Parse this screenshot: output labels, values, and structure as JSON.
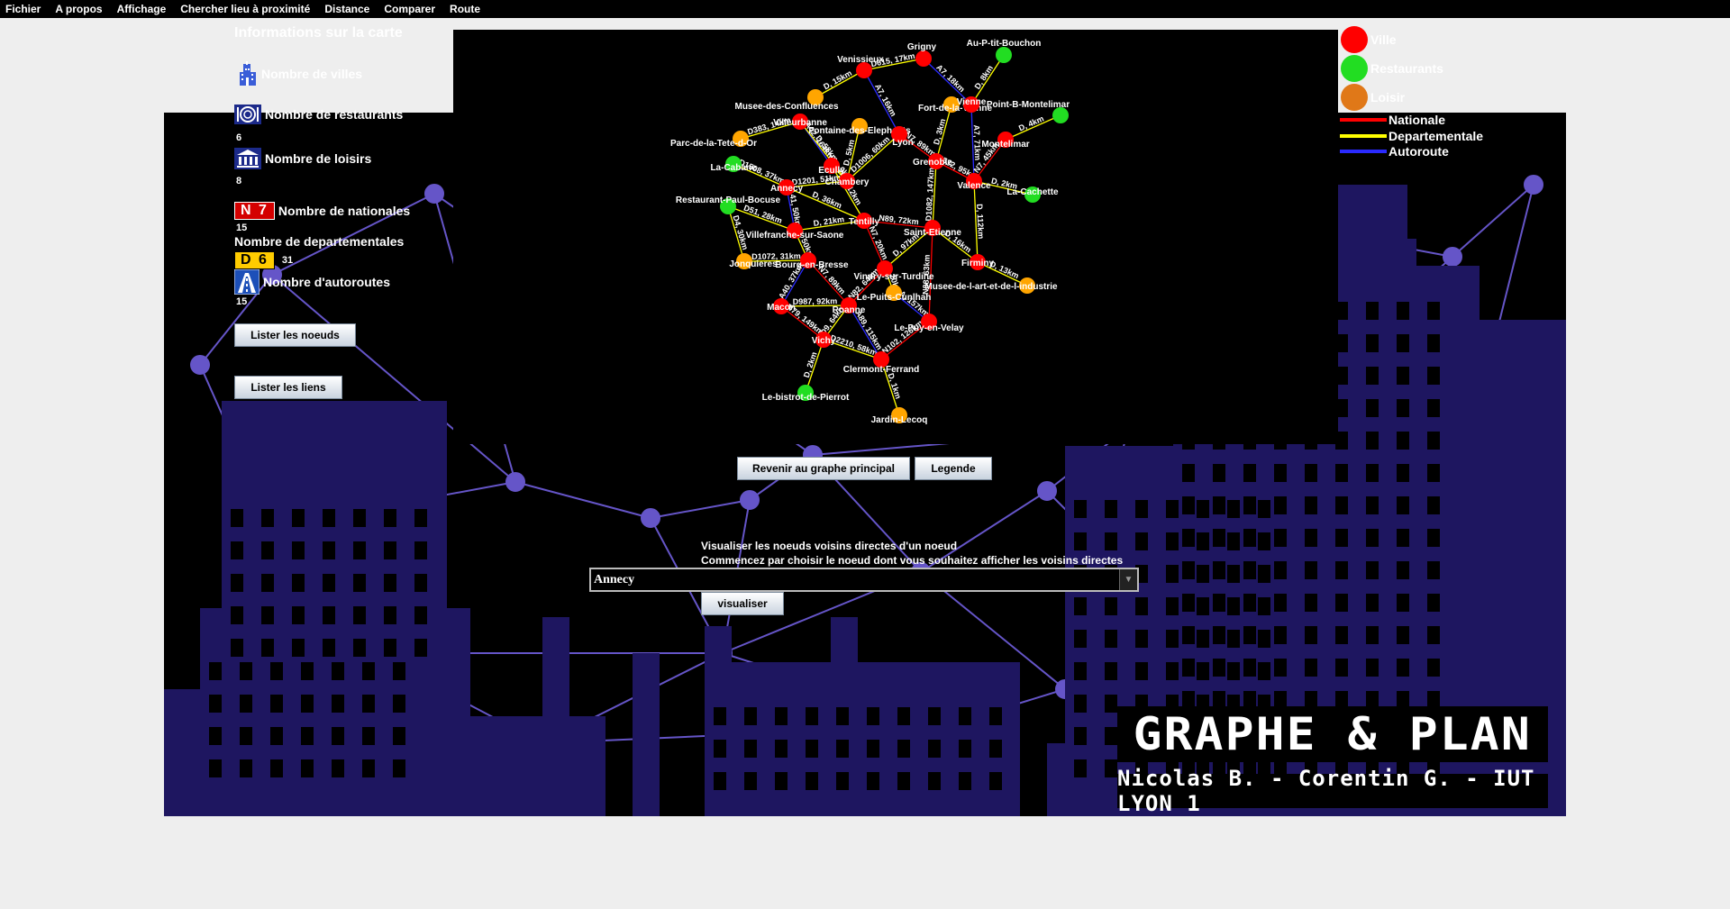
{
  "menu": [
    "Fichier",
    "A propos",
    "Affichage",
    "Chercher lieu à proximité",
    "Distance",
    "Comparer",
    "Route"
  ],
  "info": {
    "title": "Informations sur la carte",
    "villes_label": "Nombre de villes",
    "villes_count": "",
    "restaurants_label": "Nombre de restaurants",
    "restaurants_count": "6",
    "loisirs_label": "Nombre de loisirs",
    "loisirs_count": "8",
    "nationales_sign": "N 7",
    "nationales_label": "Nombre de nationales",
    "nationales_count": "15",
    "departementales_label": "Nombre de departementales",
    "departementales_sign": "D 6",
    "departementales_count": "31",
    "autoroutes_label": "Nombre d'autoroutes",
    "autoroutes_count": "15",
    "list_nodes_button": "Lister les noeuds",
    "list_links_button": "Lister les liens"
  },
  "legend": {
    "ville": "Ville",
    "restaurants": "Restaurants",
    "loisir": "Loisir",
    "nationale": "Nationale",
    "departementale": "Departementale",
    "autoroute": "Autoroute"
  },
  "colors": {
    "ville": "#ff0000",
    "restaurant": "#22dd22",
    "loisir": "#ffa500",
    "loisir_legend": "#e07818",
    "nationale": "#ff0000",
    "departementale": "#ffff00",
    "autoroute": "#2a2aff",
    "scene_navy": "#1e1660",
    "scene_network": "#6555c8"
  },
  "graph_controls": {
    "back_button": "Revenir au graphe principal",
    "legend_button": "Legende"
  },
  "neighbors": {
    "line1": "Visualiser les noeuds voisins directes d'un noeud",
    "line2": "Commencez par choisir le noeud dont vous souhaitez afficher les voisins directes",
    "selected_node": "Annecy",
    "visualize_button": "visualiser"
  },
  "branding": {
    "title": "GRAPHE & PLAN",
    "authors": "Nicolas B. - Corentin G. - IUT LYON 1"
  },
  "graph": {
    "nodes": [
      {
        "id": "grigny",
        "name": "Grigny",
        "type": "ville"
      },
      {
        "id": "au-p-tit-bouchon",
        "name": "Au-P-tit-Bouchon",
        "type": "restaurant"
      },
      {
        "id": "venissieux",
        "name": "Venissieux",
        "type": "ville"
      },
      {
        "id": "musee-confluences",
        "name": "Musee-des-Confluences",
        "type": "loisir"
      },
      {
        "id": "fort-de-la-vienne",
        "name": "Fort-de-la-Vienne",
        "type": "loisir"
      },
      {
        "id": "vienne",
        "name": "Vienne",
        "type": "ville"
      },
      {
        "id": "point-b-montelimar",
        "name": "Point-B-Montelimar",
        "type": "restaurant"
      },
      {
        "id": "villeurbanne",
        "name": "Villeurbanne",
        "type": "ville"
      },
      {
        "id": "fontaine-elephants",
        "name": "Fontaine-des-Elephants",
        "type": "loisir"
      },
      {
        "id": "lyon",
        "name": "Lyon",
        "type": "ville"
      },
      {
        "id": "parc-tete-d-or",
        "name": "Parc-de-la-Tete-d-Or",
        "type": "loisir"
      },
      {
        "id": "montelimar",
        "name": "Montelimar",
        "type": "ville"
      },
      {
        "id": "la-cabane",
        "name": "La-Cabane",
        "type": "restaurant"
      },
      {
        "id": "ecully",
        "name": "Ecully",
        "type": "ville"
      },
      {
        "id": "grenoble",
        "name": "Grenoble",
        "type": "ville"
      },
      {
        "id": "chambery",
        "name": "Chambery",
        "type": "ville"
      },
      {
        "id": "annecy",
        "name": "Annecy",
        "type": "ville"
      },
      {
        "id": "valence",
        "name": "Valence",
        "type": "ville"
      },
      {
        "id": "la-cachette",
        "name": "La-Cachette",
        "type": "restaurant"
      },
      {
        "id": "restaurant-paul-bocuse",
        "name": "Restaurant-Paul-Bocuse",
        "type": "restaurant"
      },
      {
        "id": "tentilly",
        "name": "Tentilly",
        "type": "ville"
      },
      {
        "id": "villefranche",
        "name": "Villefranche-sur-Saone",
        "type": "ville"
      },
      {
        "id": "saint-etienne",
        "name": "Saint-Etienne",
        "type": "ville"
      },
      {
        "id": "jonquieres",
        "name": "Jonquieres",
        "type": "loisir"
      },
      {
        "id": "bourg-en-bresse",
        "name": "Bourg-en-Bresse",
        "type": "ville"
      },
      {
        "id": "vindry",
        "name": "Vindry-sur-Turdine",
        "type": "ville"
      },
      {
        "id": "firminy",
        "name": "Firminy",
        "type": "ville"
      },
      {
        "id": "musee-art-industrie",
        "name": "Musee-de-l-art-et-de-l-industrie",
        "type": "loisir"
      },
      {
        "id": "puits-cunlhah",
        "name": "Le-Puits-Cunlhah",
        "type": "loisir"
      },
      {
        "id": "roanne",
        "name": "Roanne",
        "type": "ville"
      },
      {
        "id": "macon",
        "name": "Macon",
        "type": "ville"
      },
      {
        "id": "le-puy",
        "name": "Le-Puy-en-Velay",
        "type": "ville"
      },
      {
        "id": "vichy",
        "name": "Vichy",
        "type": "ville"
      },
      {
        "id": "clermont",
        "name": "Clermont-Ferrand",
        "type": "ville"
      },
      {
        "id": "bistrot-pierrot",
        "name": "Le-bistrot-de-Pierrot",
        "type": "restaurant"
      },
      {
        "id": "jardin-lecoq",
        "name": "Jardin-Lecoq",
        "type": "loisir"
      }
    ],
    "edges": [
      {
        "from": "venissieux",
        "to": "grigny",
        "road": "departementale",
        "label": "D615, 17km"
      },
      {
        "from": "grigny",
        "to": "vienne",
        "road": "autoroute",
        "label": "A7, 18km"
      },
      {
        "from": "vienne",
        "to": "au-p-tit-bouchon",
        "road": "departementale",
        "label": "D, 8km"
      },
      {
        "from": "venissieux",
        "to": "lyon",
        "road": "autoroute",
        "label": "A7, 16km"
      },
      {
        "from": "musee-confluences",
        "to": "venissieux",
        "road": "departementale",
        "label": "D, 15km"
      },
      {
        "from": "villeurbanne",
        "to": "ecully",
        "road": "autoroute",
        "label": "A42, 164km"
      },
      {
        "from": "parc-tete-d-or",
        "to": "villeurbanne",
        "road": "departementale",
        "label": "D383, 14km"
      },
      {
        "from": "fontaine-elephants",
        "to": "chambery",
        "road": "departementale",
        "label": "D, 5km"
      },
      {
        "from": "lyon",
        "to": "chambery",
        "road": "departementale",
        "label": "D1006, 60km"
      },
      {
        "from": "lyon",
        "to": "grenoble",
        "road": "nationale",
        "label": "N7, 89km"
      },
      {
        "from": "vienne",
        "to": "valence",
        "road": "autoroute",
        "label": "A7, 71km"
      },
      {
        "from": "point-b-montelimar",
        "to": "montelimar",
        "road": "departementale",
        "label": "D, 4km"
      },
      {
        "from": "montelimar",
        "to": "valence",
        "road": "nationale",
        "label": "N7, 45km"
      },
      {
        "from": "valence",
        "to": "la-cachette",
        "road": "departementale",
        "label": "D, 2km"
      },
      {
        "from": "grenoble",
        "to": "valence",
        "road": "nationale",
        "label": "N532, 95km"
      },
      {
        "from": "fort-de-la-vienne",
        "to": "grenoble",
        "road": "departementale",
        "label": "D, 3km"
      },
      {
        "from": "la-cabane",
        "to": "annecy",
        "road": "departementale",
        "label": "D1508, 37km"
      },
      {
        "from": "annecy",
        "to": "chambery",
        "road": "departementale",
        "label": "D1201, 51km"
      },
      {
        "from": "annecy",
        "to": "villefranche",
        "road": "autoroute",
        "label": "A41, 50km"
      },
      {
        "from": "restaurant-paul-bocuse",
        "to": "villefranche",
        "road": "departementale",
        "label": "D51, 28km"
      },
      {
        "from": "restaurant-paul-bocuse",
        "to": "jonquieres",
        "road": "departementale",
        "label": "D4, 30km"
      },
      {
        "from": "ecully",
        "to": "tentilly",
        "road": "departementale",
        "label": "D, 12km"
      },
      {
        "from": "tentilly",
        "to": "villefranche",
        "road": "departementale",
        "label": "D, 21km"
      },
      {
        "from": "tentilly",
        "to": "vindry",
        "road": "nationale",
        "label": "N7, 20km"
      },
      {
        "from": "tentilly",
        "to": "saint-etienne",
        "road": "nationale",
        "label": "N89, 72km"
      },
      {
        "from": "grenoble",
        "to": "saint-etienne",
        "road": "departementale",
        "label": "D1082, 147km"
      },
      {
        "from": "saint-etienne",
        "to": "firminy",
        "road": "departementale",
        "label": "D, 16km"
      },
      {
        "from": "firminy",
        "to": "musee-art-industrie",
        "road": "departementale",
        "label": "D, 13km"
      },
      {
        "from": "valence",
        "to": "firminy",
        "road": "departementale",
        "label": "D, 112km"
      },
      {
        "from": "jonquieres",
        "to": "bourg-en-bresse",
        "road": "departementale",
        "label": "D1072, 31km"
      },
      {
        "from": "villefranche",
        "to": "bourg-en-bresse",
        "road": "departementale",
        "label": "D, 50km"
      },
      {
        "from": "bourg-en-bresse",
        "to": "macon",
        "road": "autoroute",
        "label": "A40, 37km"
      },
      {
        "from": "bourg-en-bresse",
        "to": "roanne",
        "road": "nationale",
        "label": "N7, 89km"
      },
      {
        "from": "macon",
        "to": "roanne",
        "road": "departementale",
        "label": "D987, 92km"
      },
      {
        "from": "vindry",
        "to": "puits-cunlhah",
        "road": "departementale",
        "label": "D, 20km"
      },
      {
        "from": "vindry",
        "to": "roanne",
        "road": "nationale",
        "label": "N82, 64km"
      },
      {
        "from": "saint-etienne",
        "to": "le-puy",
        "road": "nationale",
        "label": "N88, 63km"
      },
      {
        "from": "saint-etienne",
        "to": "vindry",
        "road": "departementale",
        "label": "D, 97km"
      },
      {
        "from": "roanne",
        "to": "vichy",
        "road": "departementale",
        "label": "D9, 64km"
      },
      {
        "from": "macon",
        "to": "vichy",
        "road": "nationale",
        "label": "N79, 149km"
      },
      {
        "from": "vichy",
        "to": "clermont",
        "road": "departementale",
        "label": "D2210, 58km"
      },
      {
        "from": "roanne",
        "to": "clermont",
        "road": "autoroute",
        "label": "A89, 115km"
      },
      {
        "from": "le-puy",
        "to": "clermont",
        "road": "nationale",
        "label": "N102, 126km"
      },
      {
        "from": "puits-cunlhah",
        "to": "le-puy",
        "road": "autoroute",
        "label": "A, 157km"
      },
      {
        "from": "vichy",
        "to": "bistrot-pierrot",
        "road": "departementale",
        "label": "D, 2km"
      },
      {
        "from": "clermont",
        "to": "jardin-lecoq",
        "road": "departementale",
        "label": "D, 1km"
      },
      {
        "from": "villeurbanne",
        "to": "chambery",
        "road": "departementale",
        "label": "D, 58km"
      },
      {
        "from": "ecully",
        "to": "chambery",
        "road": "departementale",
        "label": "D, 9km"
      },
      {
        "from": "annecy",
        "to": "tentilly",
        "road": "departementale",
        "label": "D, 36km"
      }
    ]
  }
}
